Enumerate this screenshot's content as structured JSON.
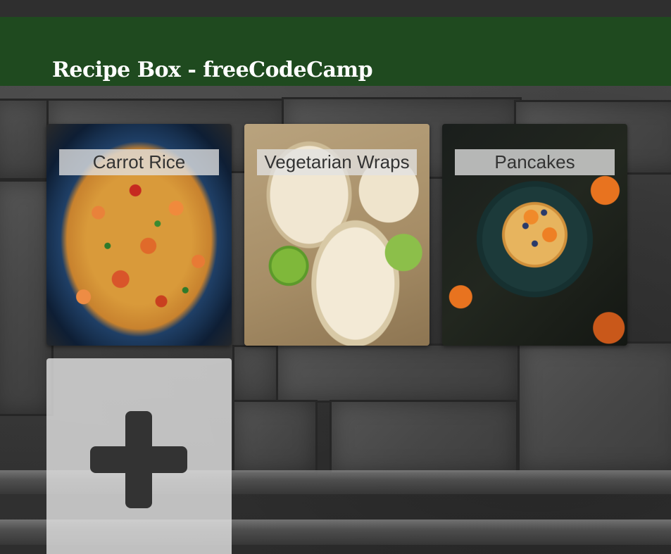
{
  "header": {
    "title": "Recipe Box - freeCodeCamp",
    "background_color": "#1f4a1f"
  },
  "recipes": [
    {
      "name": "Carrot Rice",
      "image_icon": "carrot-rice-photo"
    },
    {
      "name": "Vegetarian Wraps",
      "image_icon": "vegetarian-wraps-photo"
    },
    {
      "name": "Pancakes",
      "image_icon": "pancakes-photo"
    }
  ],
  "add_card": {
    "icon": "plus-icon"
  }
}
